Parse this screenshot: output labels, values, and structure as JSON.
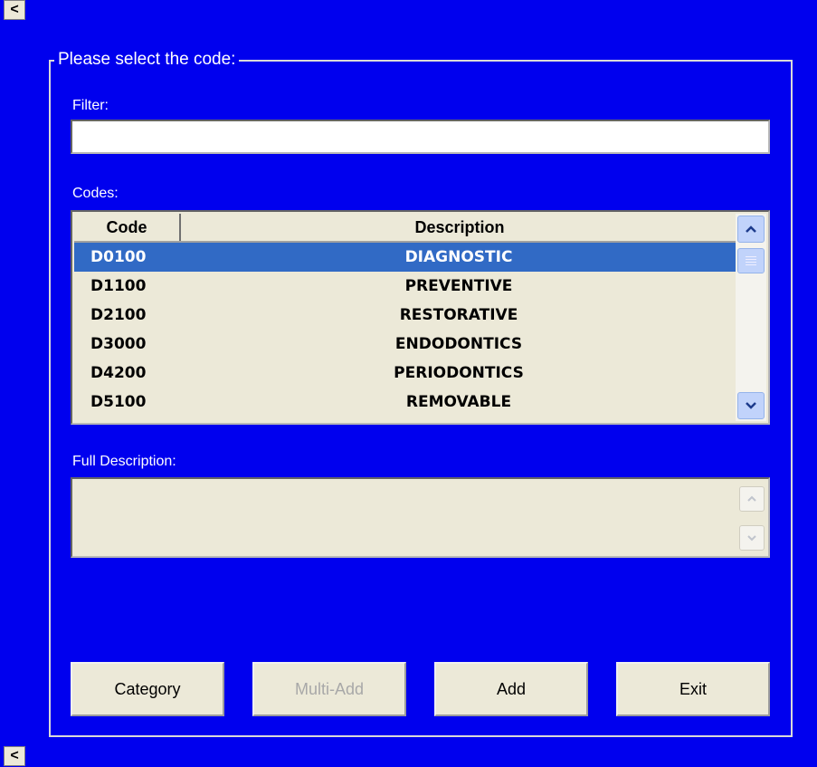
{
  "groupbox": {
    "title": "Please select the code:"
  },
  "filter": {
    "label": "Filter:",
    "value": ""
  },
  "codes": {
    "label": "Codes:",
    "columns": [
      "Code",
      "Description"
    ],
    "rows": [
      {
        "code": "D0100",
        "description": "DIAGNOSTIC",
        "selected": true
      },
      {
        "code": "D1100",
        "description": "PREVENTIVE"
      },
      {
        "code": "D2100",
        "description": "RESTORATIVE"
      },
      {
        "code": "D3000",
        "description": "ENDODONTICS"
      },
      {
        "code": "D4200",
        "description": "PERIODONTICS"
      },
      {
        "code": "D5100",
        "description": "REMOVABLE"
      }
    ]
  },
  "full_description": {
    "label": "Full Description:",
    "value": ""
  },
  "buttons": {
    "category": "Category",
    "multi_add": "Multi-Add",
    "add": "Add",
    "exit": "Exit"
  },
  "edge_buttons": {
    "top": "<",
    "bottom": "<"
  },
  "colors": {
    "background": "#0000ee",
    "selection": "#316ac5",
    "panel": "#ece9d8"
  }
}
